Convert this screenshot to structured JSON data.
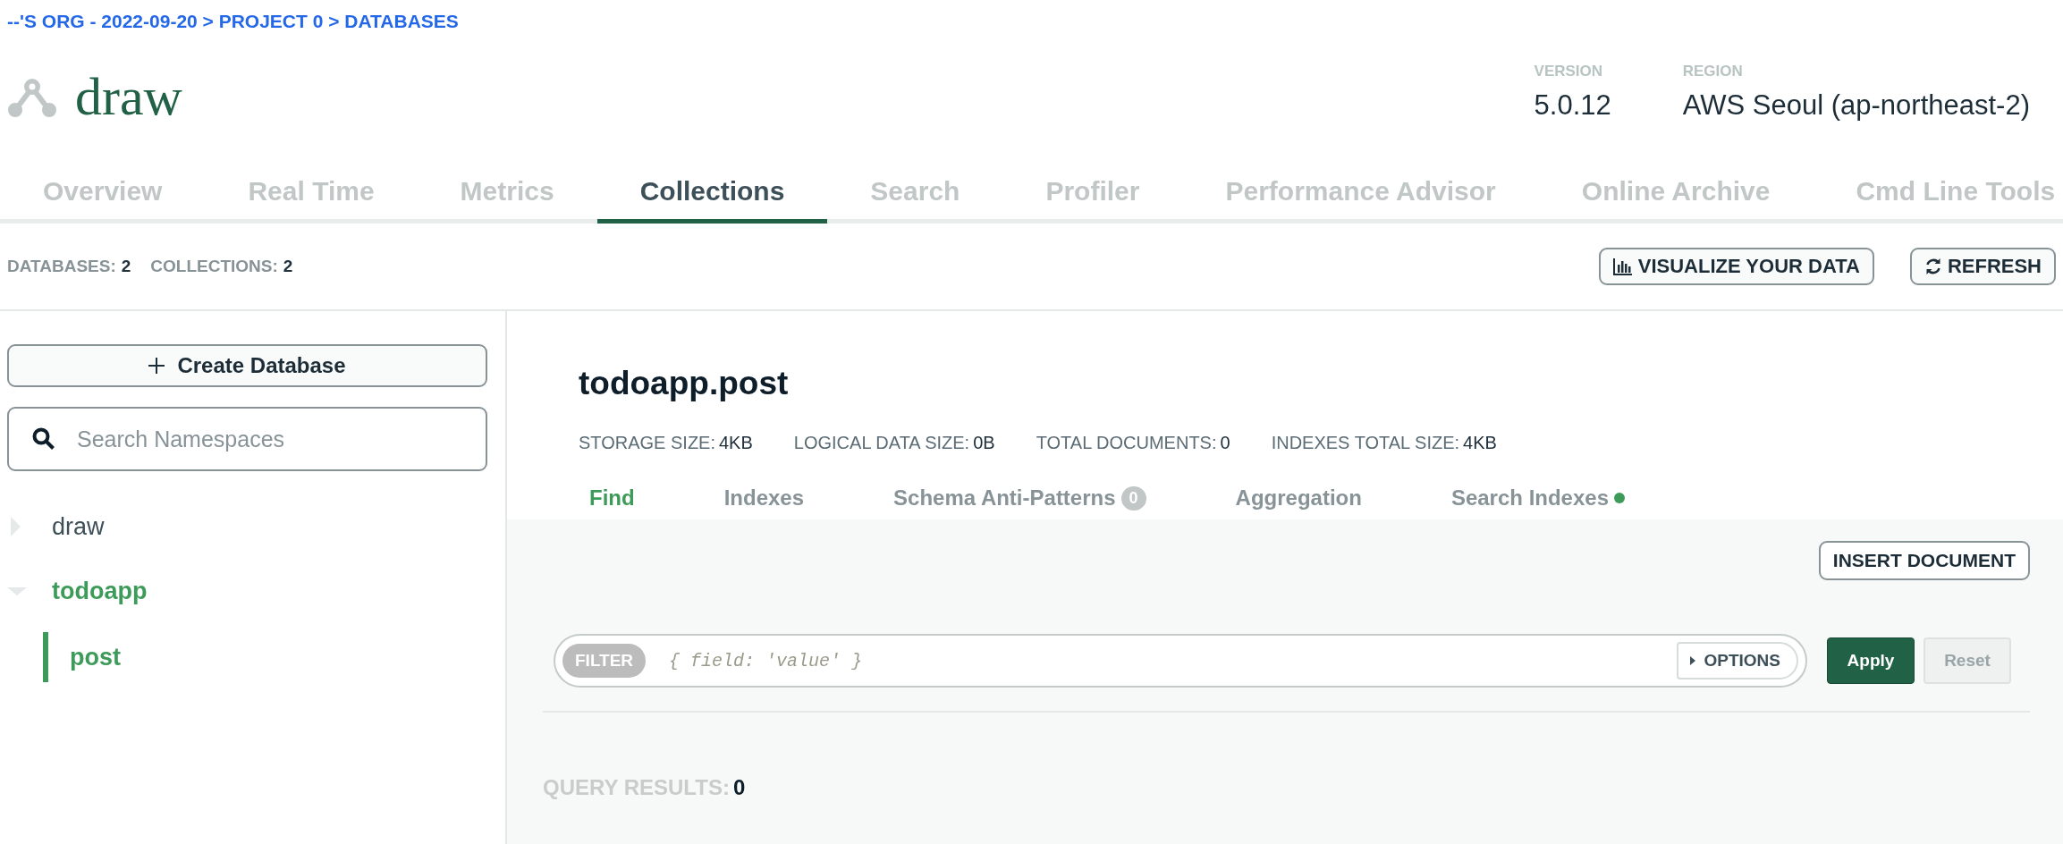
{
  "breadcrumb": "--'S ORG - 2022-09-20 > PROJECT 0 > DATABASES",
  "cluster": {
    "name": "draw",
    "info": [
      {
        "label": "VERSION",
        "value": "5.0.12"
      },
      {
        "label": "REGION",
        "value": "AWS Seoul (ap-northeast-2)"
      }
    ]
  },
  "tabs": [
    {
      "label": "Overview",
      "selected": false
    },
    {
      "label": "Real Time",
      "selected": false
    },
    {
      "label": "Metrics",
      "selected": false
    },
    {
      "label": "Collections",
      "selected": true
    },
    {
      "label": "Search",
      "selected": false
    },
    {
      "label": "Profiler",
      "selected": false
    },
    {
      "label": "Performance Advisor",
      "selected": false
    },
    {
      "label": "Online Archive",
      "selected": false
    },
    {
      "label": "Cmd Line Tools",
      "selected": false
    }
  ],
  "counts": [
    {
      "label": "DATABASES:",
      "value": "2"
    },
    {
      "label": "COLLECTIONS:",
      "value": "2"
    }
  ],
  "actions": [
    {
      "kind": "chart",
      "label": "VISUALIZE YOUR DATA"
    },
    {
      "kind": "refresh",
      "label": "REFRESH"
    }
  ],
  "sidebar": {
    "create_button": "Create Database",
    "search": {
      "placeholder": "Search Namespaces"
    },
    "databases": [
      {
        "name": "draw",
        "expanded": false,
        "selected": false
      },
      {
        "name": "todoapp",
        "expanded": true,
        "selected": true,
        "children": [
          {
            "name": "post",
            "selected": true
          }
        ]
      }
    ]
  },
  "collection": {
    "title": "todoapp.post",
    "stats": [
      {
        "label": "STORAGE SIZE:",
        "value": "4KB"
      },
      {
        "label": "LOGICAL DATA SIZE:",
        "value": "0B"
      },
      {
        "label": "TOTAL DOCUMENTS:",
        "value": "0"
      },
      {
        "label": "INDEXES TOTAL SIZE:",
        "value": "4KB"
      }
    ],
    "tabs": [
      {
        "label": "Find",
        "selected": true
      },
      {
        "label": "Indexes",
        "selected": false
      },
      {
        "label": "Schema Anti-Patterns",
        "selected": false,
        "badge": "0"
      },
      {
        "label": "Aggregation",
        "selected": false
      },
      {
        "label": "Search Indexes",
        "selected": false,
        "color": "#3d9b5a"
      }
    ],
    "insert_button": "INSERT DOCUMENT",
    "filter": {
      "label": "FILTER",
      "placeholder": "{ field: 'value' }",
      "options": "OPTIONS"
    },
    "apply_button": "Apply",
    "reset_button": "Reset",
    "results": {
      "label": "QUERY RESULTS:",
      "value": "0"
    }
  }
}
